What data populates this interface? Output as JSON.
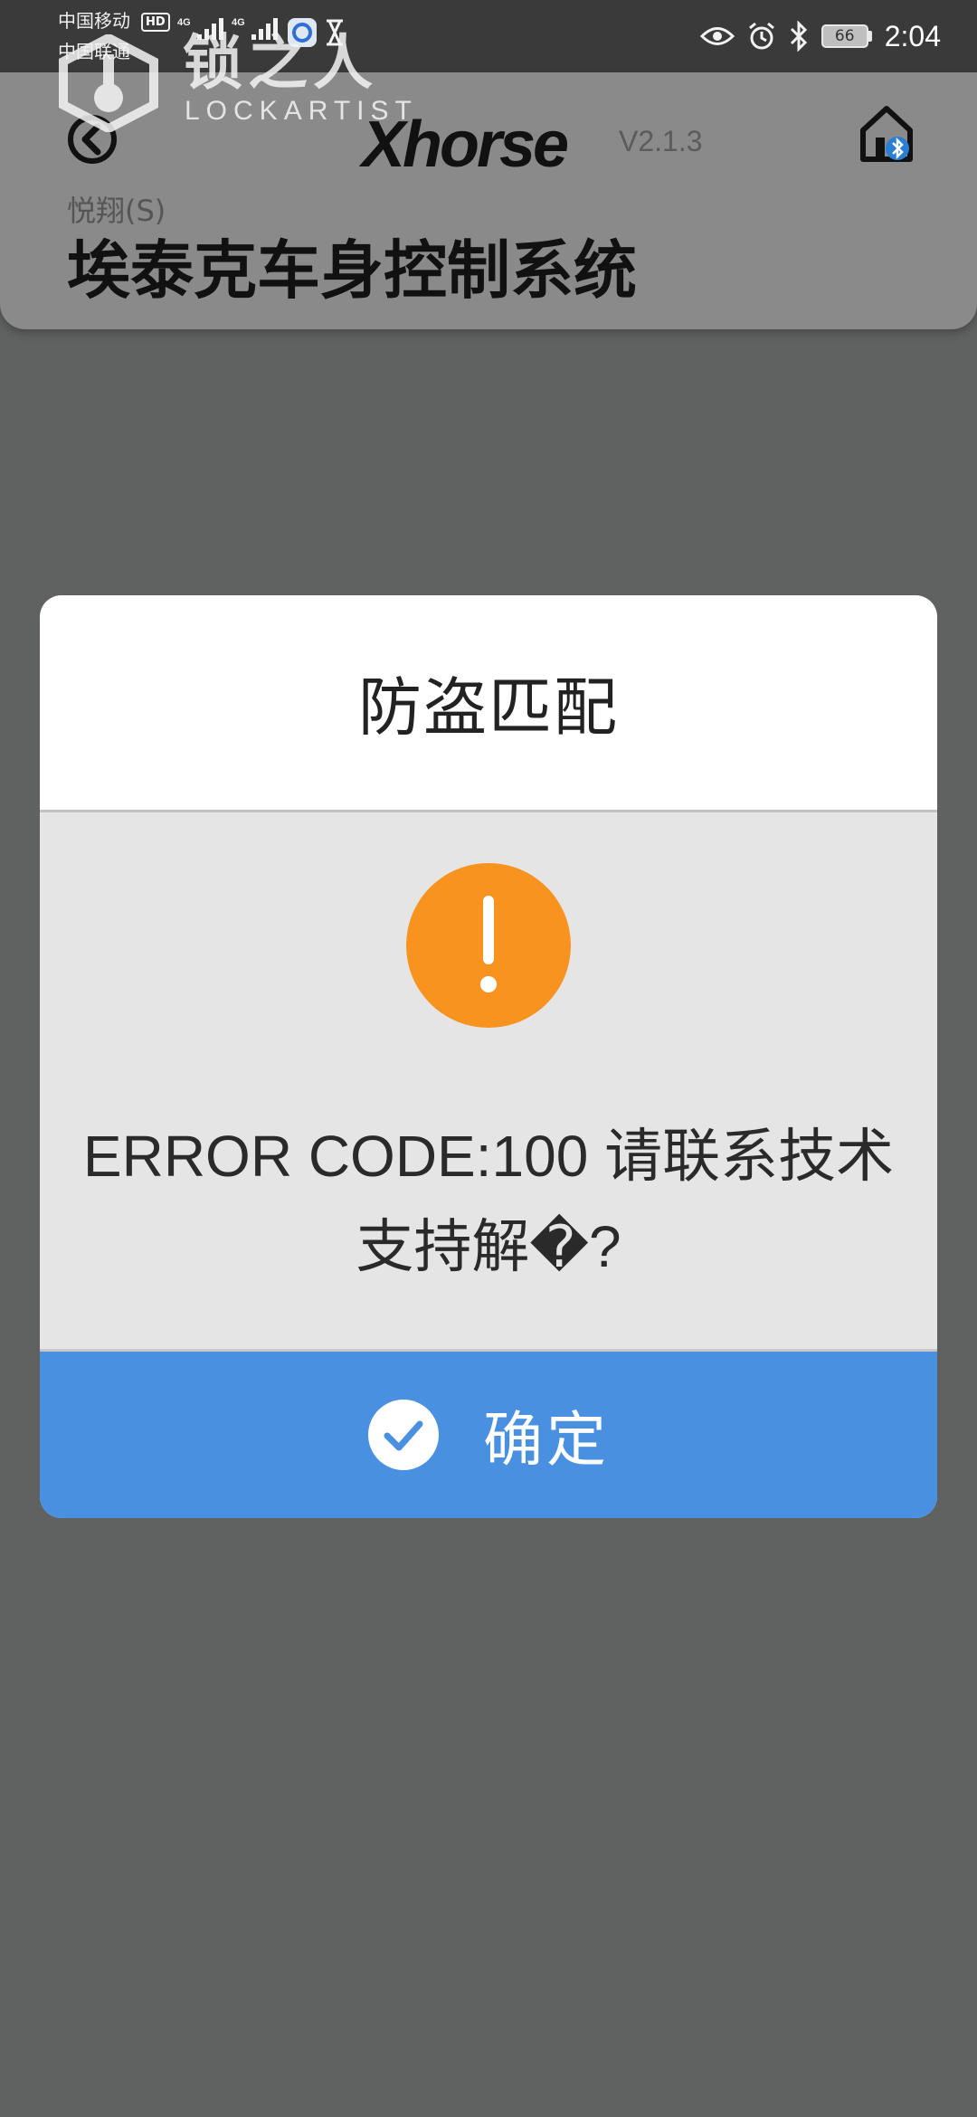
{
  "status_bar": {
    "carrier_1": "中国移动",
    "carrier_2": "中国联通",
    "hd_label": "HD",
    "network_1": "4G",
    "network_2": "4G",
    "battery_level": "66",
    "time": "2:04",
    "icons": [
      "signal-icon",
      "app-notification-icon",
      "hourglass-icon",
      "eye-icon",
      "alarm-icon",
      "bluetooth-icon",
      "battery-icon"
    ]
  },
  "watermark": {
    "name_cn": "锁之人",
    "name_en": "LOCKARTIST"
  },
  "header": {
    "brand": "Xhorse",
    "version": "V2.1.3",
    "vehicle_model": "悦翔(S)",
    "system_title": "埃泰克车身控制系统",
    "icons": [
      "back-arrow-icon",
      "home-bluetooth-icon"
    ]
  },
  "dialog": {
    "title": "防盗匹配",
    "message": "ERROR CODE:100 请联系技术支持解�?",
    "confirm_label": "确定",
    "icons": [
      "warning-icon",
      "check-circle-icon"
    ],
    "colors": {
      "warning": "#f7931e",
      "confirm_bg": "#4a90e0",
      "overlay": "#606161"
    }
  }
}
